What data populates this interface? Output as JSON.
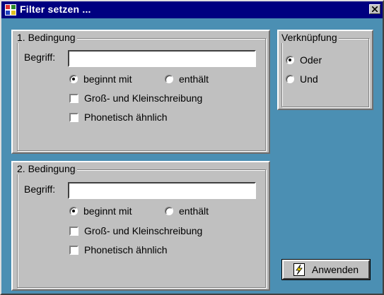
{
  "window": {
    "title": "Filter setzen ..."
  },
  "condition1": {
    "legend": "1. Bedingung",
    "term_label": "Begriff:",
    "term_value": "",
    "starts_with_label": "beginnt mit",
    "contains_label": "enthält",
    "selected_mode": "beginnt mit",
    "case_label": "Groß- und Kleinschreibung",
    "case_checked": false,
    "phonetic_label": "Phonetisch ähnlich",
    "phonetic_checked": false
  },
  "condition2": {
    "legend": "2. Bedingung",
    "term_label": "Begriff:",
    "term_value": "",
    "starts_with_label": "beginnt mit",
    "contains_label": "enthält",
    "selected_mode": "beginnt mit",
    "case_label": "Groß- und Kleinschreibung",
    "case_checked": false,
    "phonetic_label": "Phonetisch ähnlich",
    "phonetic_checked": false
  },
  "link": {
    "legend": "Verknüpfung",
    "or_label": "Oder",
    "and_label": "Und",
    "selected": "Oder"
  },
  "apply_button": {
    "label": "Anwenden",
    "icon": "lightning-icon"
  },
  "colors": {
    "titlebar": "#000080",
    "background": "#4b8fb3",
    "panel": "#c0c0c0"
  }
}
